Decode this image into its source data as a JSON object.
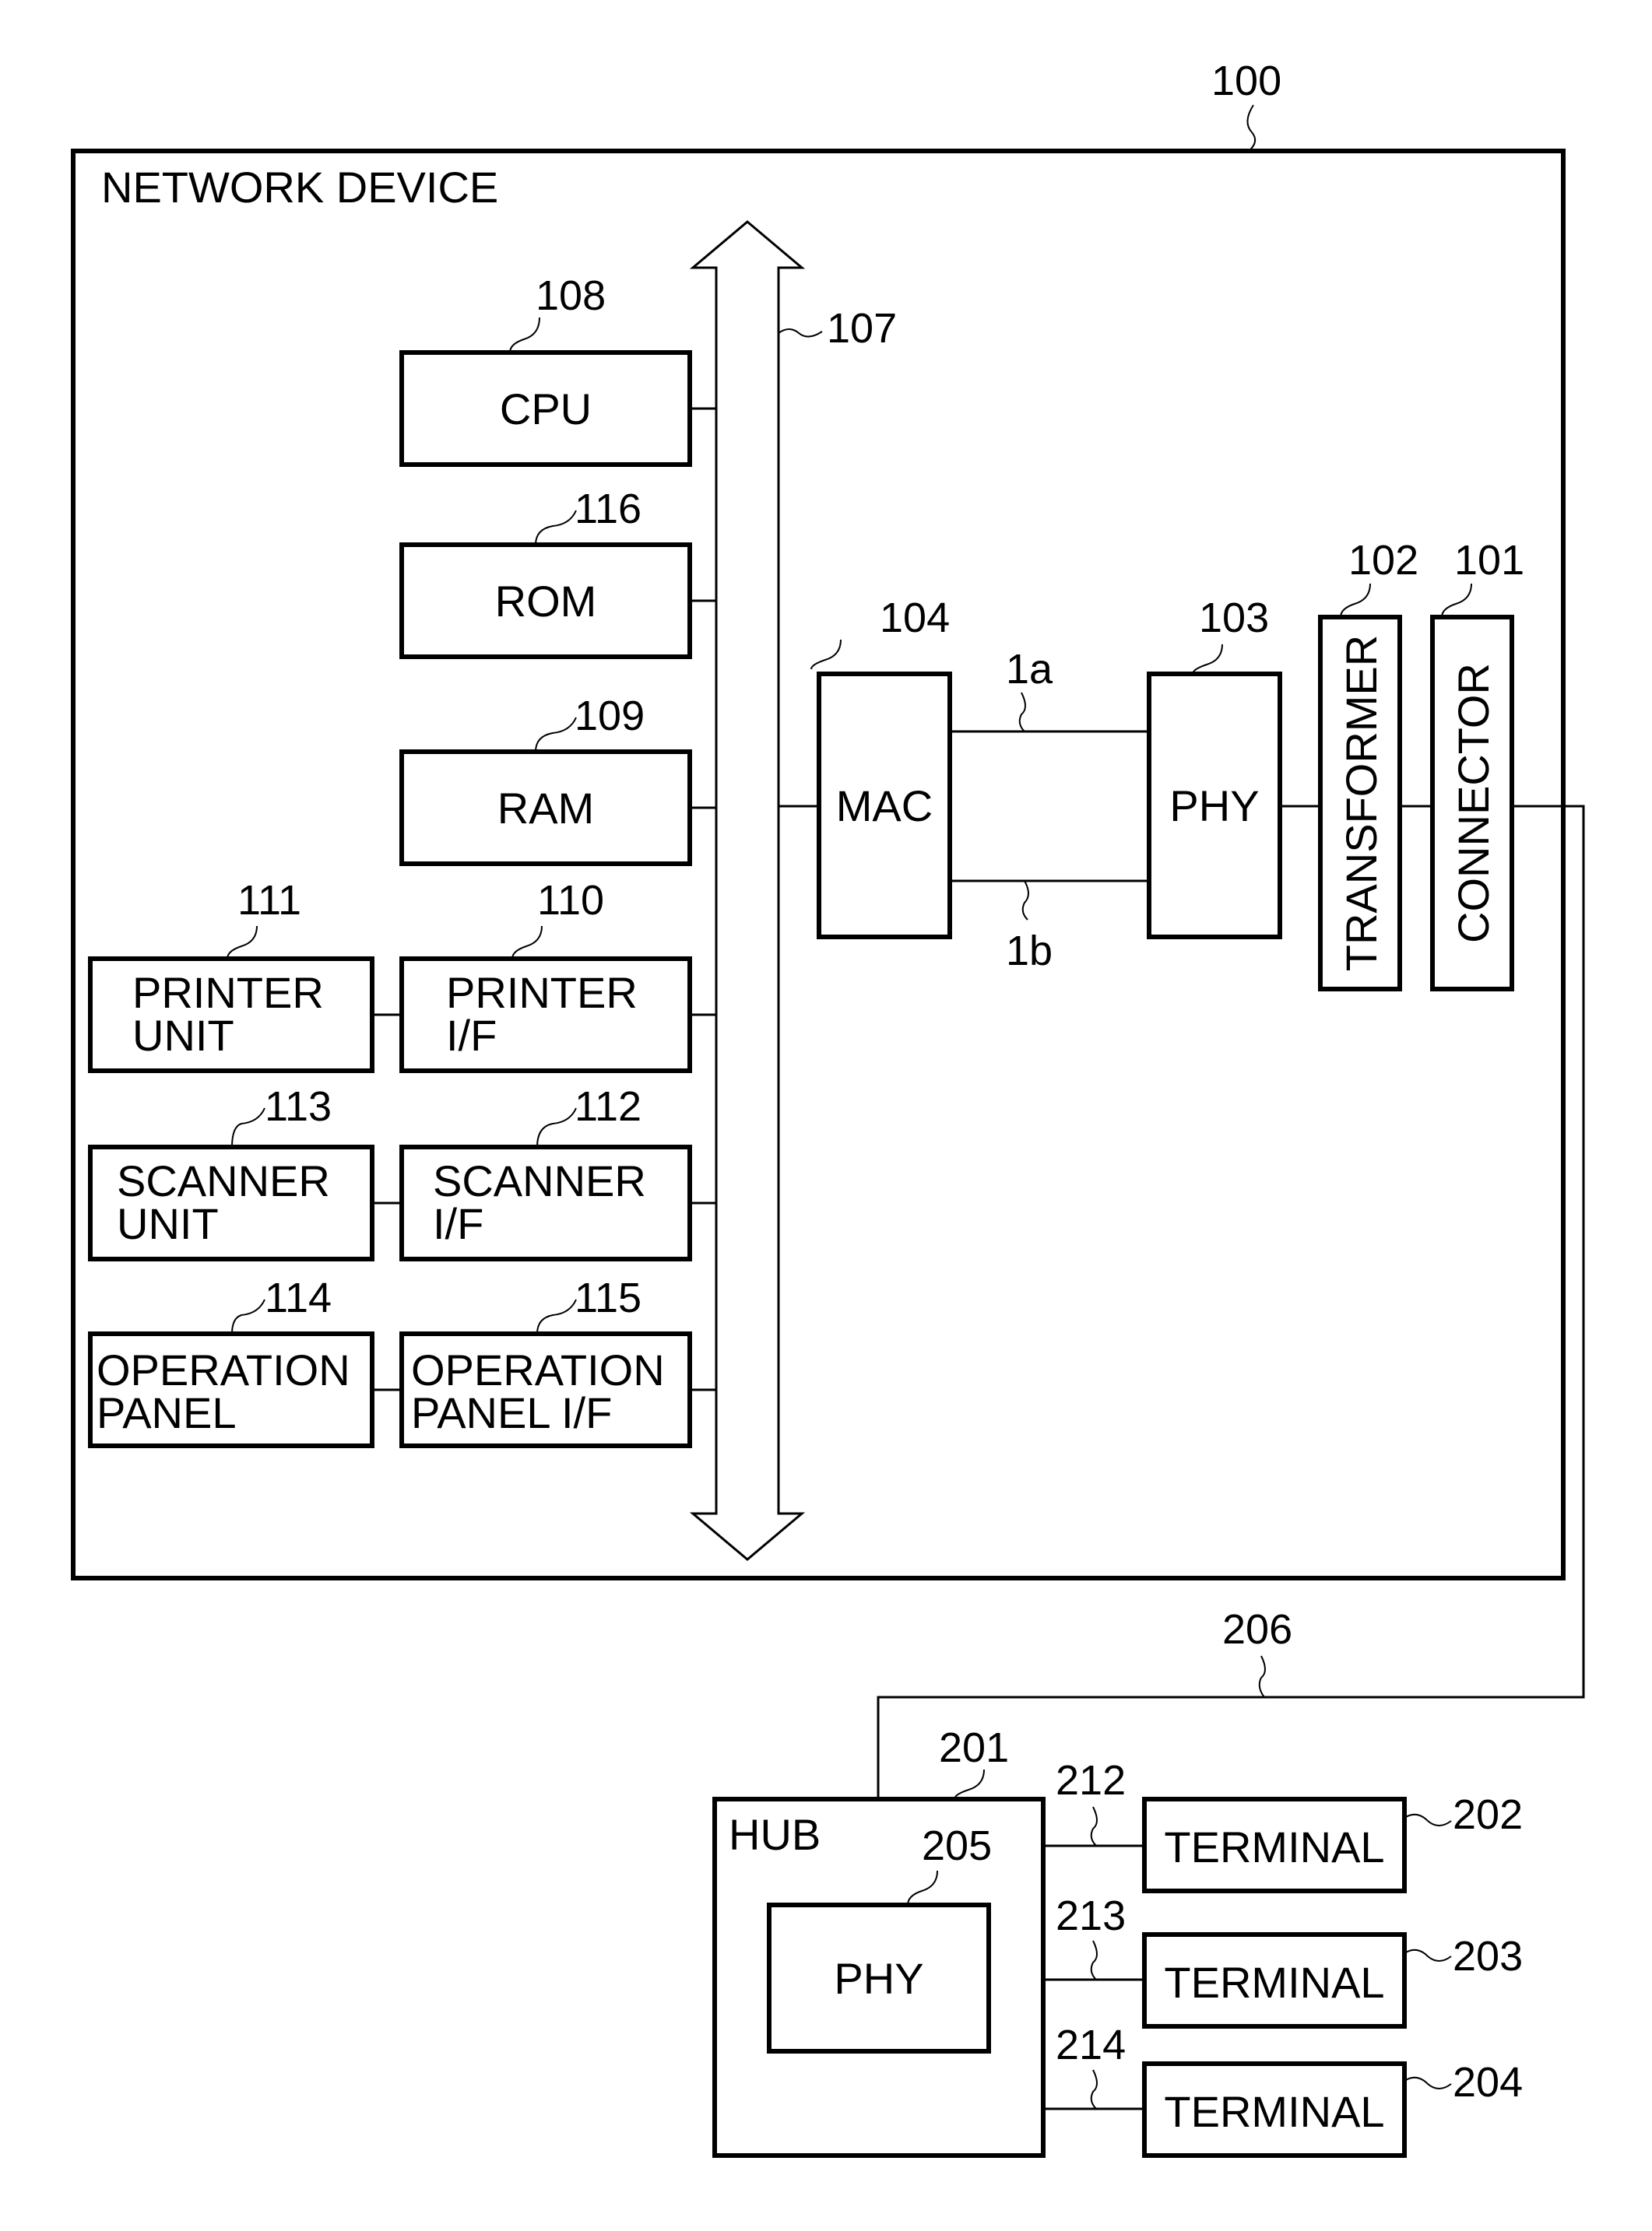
{
  "figure": {
    "device_ref": "100",
    "device_title": "NETWORK DEVICE",
    "bus_ref": "107",
    "cable_ref": "206"
  },
  "blocks": {
    "cpu": {
      "ref": "108",
      "lines": [
        "CPU"
      ]
    },
    "rom": {
      "ref": "116",
      "lines": [
        "ROM"
      ]
    },
    "ram": {
      "ref": "109",
      "lines": [
        "RAM"
      ]
    },
    "printer_unit": {
      "ref": "111",
      "lines": [
        "PRINTER",
        "UNIT"
      ]
    },
    "printer_if": {
      "ref": "110",
      "lines": [
        "PRINTER",
        "I/F"
      ]
    },
    "scanner_unit": {
      "ref": "113",
      "lines": [
        "SCANNER",
        "UNIT"
      ]
    },
    "scanner_if": {
      "ref": "112",
      "lines": [
        "SCANNER",
        "I/F"
      ]
    },
    "operation_panel": {
      "ref": "114",
      "lines": [
        "OPERATION",
        "PANEL"
      ]
    },
    "operation_panel_if": {
      "ref": "115",
      "lines": [
        "OPERATION",
        "PANEL I/F"
      ]
    },
    "mac": {
      "ref": "104",
      "lines": [
        "MAC"
      ]
    },
    "phy": {
      "ref": "103",
      "lines": [
        "PHY"
      ]
    },
    "transformer": {
      "ref": "102",
      "lines": [
        "TRANSFORMER"
      ]
    },
    "connector": {
      "ref": "101",
      "lines": [
        "CONNECTOR"
      ]
    },
    "hub": {
      "ref": "201",
      "lines": [
        "HUB"
      ]
    },
    "hub_phy": {
      "ref": "205",
      "lines": [
        "PHY"
      ]
    },
    "terminal_1": {
      "ref": "202",
      "lines": [
        "TERMINAL"
      ]
    },
    "terminal_2": {
      "ref": "203",
      "lines": [
        "TERMINAL"
      ]
    },
    "terminal_3": {
      "ref": "204",
      "lines": [
        "TERMINAL"
      ]
    }
  },
  "links": {
    "mac_phy_a": "1a",
    "mac_phy_b": "1b",
    "hub_terminal_1": "212",
    "hub_terminal_2": "213",
    "hub_terminal_3": "214"
  }
}
